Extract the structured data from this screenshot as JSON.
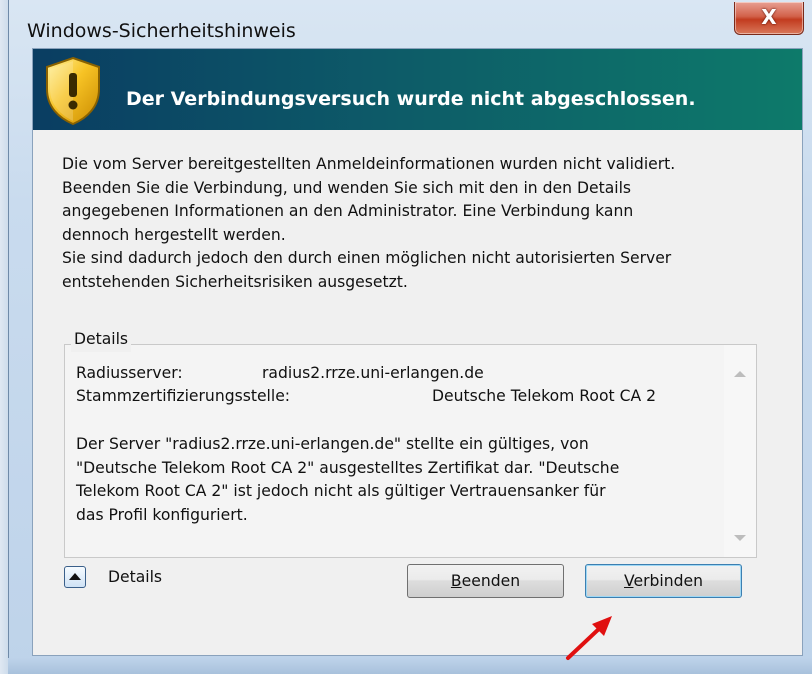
{
  "window": {
    "title": "Windows-Sicherheitshinweis",
    "close_glyph": "X"
  },
  "banner": {
    "icon": "warning-shield-icon",
    "headline": "Der Verbindungsversuch wurde nicht abgeschlossen."
  },
  "message": {
    "lines": [
      "Die vom Server bereitgestellten Anmeldeinformationen wurden nicht validiert.",
      "Beenden Sie die Verbindung, und wenden Sie sich mit den in den Details",
      "angegebenen Informationen an den Administrator. Eine Verbindung kann",
      "dennoch hergestellt werden.",
      "Sie sind dadurch jedoch den durch einen möglichen nicht autorisierten Server",
      "entstehenden Sicherheitsrisiken ausgesetzt."
    ]
  },
  "details": {
    "legend": "Details",
    "radius_label": "Radiusserver:",
    "radius_value": "radius2.rrze.uni-erlangen.de",
    "ca_label": "Stammzertifizierungsstelle:",
    "ca_value": "Deutsche Telekom Root CA 2",
    "text_lines": [
      "Der Server \"radius2.rrze.uni-erlangen.de\" stellte ein gültiges, von",
      "\"Deutsche Telekom Root CA 2\" ausgestelltes Zertifikat dar. \"Deutsche",
      "Telekom Root CA 2\" ist jedoch nicht als gültiger Vertrauensanker für",
      "das Profil konfiguriert."
    ]
  },
  "footer": {
    "toggle_label": "Details",
    "beenden_accel": "B",
    "beenden_rest": "eenden",
    "verbinden_accel": "V",
    "verbinden_rest": "erbinden"
  },
  "colors": {
    "banner_start": "#0a3d62",
    "banner_end": "#0d7a6a",
    "close_red": "#c23b1f",
    "annotation_arrow": "#e01010"
  }
}
